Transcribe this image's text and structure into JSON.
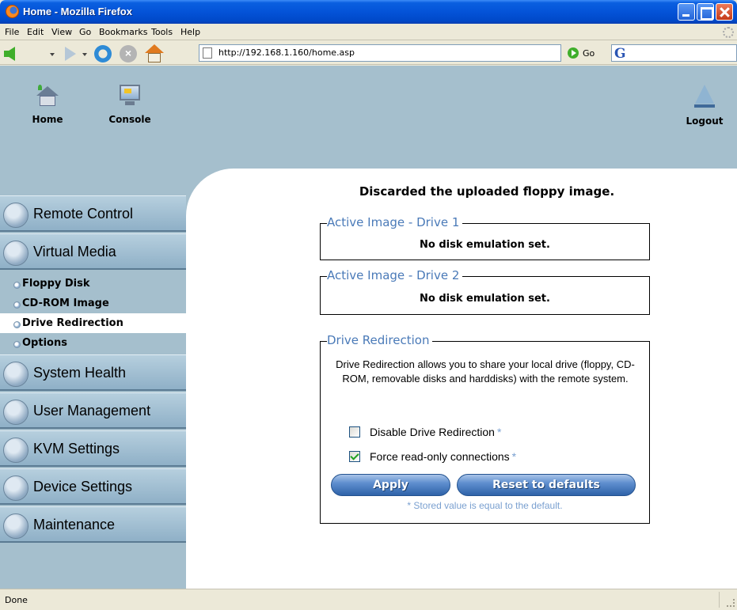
{
  "window": {
    "title": "Home - Mozilla Firefox"
  },
  "menubar": {
    "items": [
      "File",
      "Edit",
      "View",
      "Go",
      "Bookmarks",
      "Tools",
      "Help"
    ]
  },
  "toolbar": {
    "url": "http://192.168.1.160/home.asp",
    "go_label": "Go",
    "icons": [
      "back-icon",
      "forward-icon",
      "reload-icon",
      "stop-icon",
      "home-icon",
      "go-icon",
      "search-engine-icon"
    ]
  },
  "header": {
    "nav": [
      {
        "label": "Home",
        "icon": "home-icon"
      },
      {
        "label": "Console",
        "icon": "console-icon"
      },
      {
        "label": "Logout",
        "icon": "logout-icon"
      }
    ]
  },
  "sidebar": {
    "sections": [
      {
        "label": "Remote Control",
        "icon": "remote-control-icon"
      },
      {
        "label": "Virtual Media",
        "icon": "virtual-media-icon"
      },
      {
        "label": "System Health",
        "icon": "system-health-icon"
      },
      {
        "label": "User Management",
        "icon": "user-management-icon"
      },
      {
        "label": "KVM Settings",
        "icon": "kvm-settings-icon"
      },
      {
        "label": "Device Settings",
        "icon": "device-settings-icon"
      },
      {
        "label": "Maintenance",
        "icon": "maintenance-icon"
      }
    ],
    "submenu": [
      {
        "label": "Floppy Disk",
        "active": false
      },
      {
        "label": "CD-ROM Image",
        "active": false
      },
      {
        "label": "Drive Redirection",
        "active": true
      },
      {
        "label": "Options",
        "active": false
      }
    ]
  },
  "main": {
    "status_message": "Discarded the uploaded floppy image.",
    "drive1": {
      "legend": "Active Image - Drive 1",
      "status": "No disk emulation set."
    },
    "drive2": {
      "legend": "Active Image - Drive 2",
      "status": "No disk emulation set."
    },
    "redirection": {
      "legend": "Drive Redirection",
      "description": "Drive Redirection allows you to share your local drive (floppy, CD-ROM, removable disks and harddisks) with the remote system.",
      "options": [
        {
          "label": "Disable Drive Redirection",
          "checked": false,
          "star": "*"
        },
        {
          "label": "Force read-only connections",
          "checked": true,
          "star": "*"
        }
      ],
      "apply_label": "Apply",
      "reset_label": "Reset to defaults",
      "note": "* Stored value is equal to the default."
    }
  },
  "statusbar": {
    "text": "Done"
  },
  "colors": {
    "titlebar": "#0453d8",
    "panel_bg": "#a5bfcd",
    "legend": "#4a7ab8",
    "button": "#2e62a8",
    "note": "#7aa0d0"
  }
}
